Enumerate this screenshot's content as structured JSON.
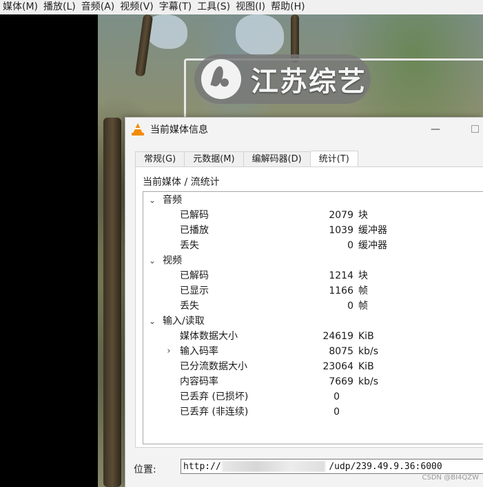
{
  "menubar": [
    {
      "id": "media",
      "label": "媒体(M)"
    },
    {
      "id": "playback",
      "label": "播放(L)"
    },
    {
      "id": "audio",
      "label": "音频(A)"
    },
    {
      "id": "video",
      "label": "视频(V)"
    },
    {
      "id": "subtitle",
      "label": "字幕(T)"
    },
    {
      "id": "tools",
      "label": "工具(S)"
    },
    {
      "id": "view",
      "label": "视图(I)"
    },
    {
      "id": "help",
      "label": "帮助(H)"
    }
  ],
  "video": {
    "logo_text": "江苏综艺"
  },
  "dialog": {
    "title": "当前媒体信息",
    "minimize_glyph": "—",
    "tabs": [
      {
        "id": "general",
        "label": "常规(G)"
      },
      {
        "id": "metadata",
        "label": "元数据(M)"
      },
      {
        "id": "codec",
        "label": "编解码器(D)"
      },
      {
        "id": "statistics",
        "label": "统计(T)",
        "active": true
      }
    ],
    "caption": "当前媒体 / 流统计",
    "stats": {
      "audio": {
        "label": "音频",
        "rows": [
          {
            "name": "已解码",
            "value": "2079",
            "unit": "块"
          },
          {
            "name": "已播放",
            "value": "1039",
            "unit": "缓冲器"
          },
          {
            "name": "丢失",
            "value": "0",
            "unit": "缓冲器"
          }
        ]
      },
      "video": {
        "label": "视频",
        "rows": [
          {
            "name": "已解码",
            "value": "1214",
            "unit": "块"
          },
          {
            "name": "已显示",
            "value": "1166",
            "unit": "帧"
          },
          {
            "name": "丢失",
            "value": "0",
            "unit": "帧"
          }
        ]
      },
      "input": {
        "label": "输入/读取",
        "rows": [
          {
            "name": "媒体数据大小",
            "value": "24619",
            "unit": "KiB"
          },
          {
            "name": "输入码率",
            "value": "8075",
            "unit": "kb/s"
          },
          {
            "name": "已分流数据大小",
            "value": "23064",
            "unit": "KiB"
          },
          {
            "name": "内容码率",
            "value": "7669",
            "unit": "kb/s"
          },
          {
            "name": "已丢弃 (已损坏)",
            "value": "0",
            "unit": ""
          },
          {
            "name": "已丢弃 (非连续)",
            "value": "0",
            "unit": ""
          }
        ]
      }
    },
    "location": {
      "label": "位置:",
      "value": "http://                    /udp/239.49.9.36:6000"
    },
    "watermark": "CSDN @BI4QZW"
  },
  "icons": {
    "expanded": "chevron-down-icon",
    "collapsed": "chevron-right-icon",
    "app": "vlc-cone-icon"
  },
  "colors": {
    "vlc_orange": "#f28c00"
  }
}
